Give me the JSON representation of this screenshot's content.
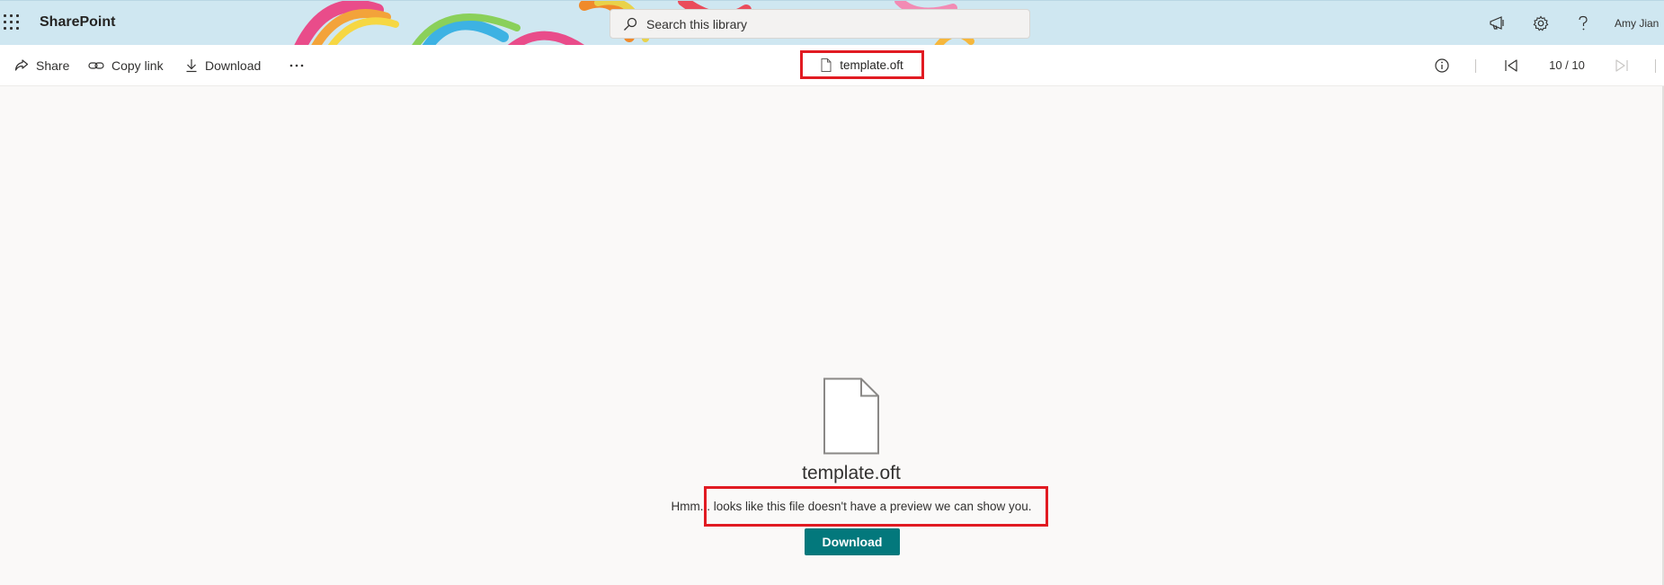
{
  "header": {
    "app_name": "SharePoint",
    "search_placeholder": "Search this library",
    "user_name": "Amy Jian",
    "icons": [
      "waffle-icon",
      "megaphone-icon",
      "settings-icon",
      "help-icon"
    ]
  },
  "command_bar": {
    "share_label": "Share",
    "copy_link_label": "Copy link",
    "download_label": "Download",
    "file_title": "template.oft",
    "page_counter": "10 / 10"
  },
  "preview": {
    "file_name": "template.oft",
    "message": "Hmm... looks like this file doesn't have a preview we can show you.",
    "download_button_label": "Download"
  },
  "colors": {
    "accent": "#03787c",
    "highlight": "#e11b22",
    "header_bg": "#cfe7f1",
    "canvas_bg": "#faf9f8"
  }
}
